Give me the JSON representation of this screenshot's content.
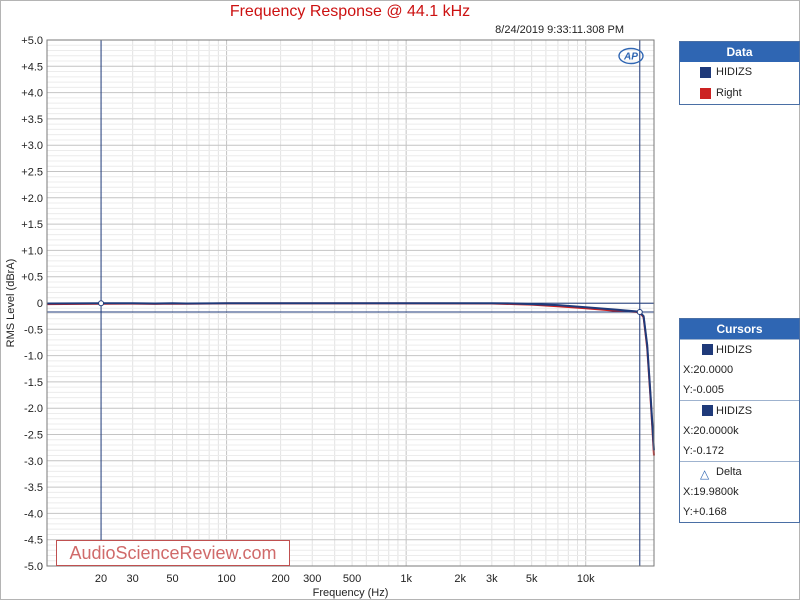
{
  "chart_data": {
    "type": "line",
    "title": "Frequency Response @ 44.1 kHz",
    "timestamp": "8/24/2019 9:33:11.308 PM",
    "xlabel": "Frequency (Hz)",
    "ylabel": "RMS Level (dBrA)",
    "xscale": "log",
    "xlim": [
      10,
      24000
    ],
    "ylim": [
      -5.0,
      5.0
    ],
    "grid": true,
    "x_tick_labels": [
      "20",
      "30",
      "50",
      "100",
      "200",
      "300",
      "500",
      "1k",
      "2k",
      "3k",
      "5k",
      "10k"
    ],
    "x_tick_values": [
      20,
      30,
      50,
      100,
      200,
      300,
      500,
      1000,
      2000,
      3000,
      5000,
      10000
    ],
    "y_tick_labels": [
      "+5.0",
      "+4.5",
      "+4.0",
      "+3.5",
      "+3.0",
      "+2.5",
      "+2.0",
      "+1.5",
      "+1.0",
      "+0.5",
      "0",
      "-0.5",
      "-1.0",
      "-1.5",
      "-2.0",
      "-2.5",
      "-3.0",
      "-3.5",
      "-4.0",
      "-4.5",
      "-5.0"
    ],
    "y_tick_values": [
      5.0,
      4.5,
      4.0,
      3.5,
      3.0,
      2.5,
      2.0,
      1.5,
      1.0,
      0.5,
      0,
      -0.5,
      -1.0,
      -1.5,
      -2.0,
      -2.5,
      -3.0,
      -3.5,
      -4.0,
      -4.5,
      -5.0
    ],
    "series": [
      {
        "name": "HIDIZS",
        "color": "#1f3a7a",
        "x": [
          10,
          20,
          30,
          40,
          50,
          60,
          100,
          500,
          1000,
          3000,
          4000,
          5000,
          7000,
          10000,
          15000,
          19000,
          20000,
          21000,
          22000,
          23000,
          24000
        ],
        "y": [
          -0.01,
          -0.005,
          -0.003,
          -0.01,
          -0.005,
          -0.01,
          -0.003,
          -0.003,
          -0.003,
          -0.003,
          -0.01,
          -0.02,
          -0.04,
          -0.08,
          -0.13,
          -0.16,
          -0.172,
          -0.25,
          -0.8,
          -1.8,
          -2.8
        ]
      },
      {
        "name": "Right",
        "color": "#cc2222",
        "x": [
          10,
          20,
          30,
          40,
          50,
          60,
          100,
          500,
          1000,
          3000,
          4000,
          5000,
          7000,
          10000,
          15000,
          19000,
          20000,
          21000,
          22000,
          23000,
          24000
        ],
        "y": [
          -0.02,
          -0.015,
          -0.012,
          -0.018,
          -0.012,
          -0.015,
          -0.008,
          -0.008,
          -0.008,
          -0.01,
          -0.02,
          -0.03,
          -0.06,
          -0.1,
          -0.15,
          -0.17,
          -0.18,
          -0.27,
          -0.85,
          -1.85,
          -2.9
        ]
      }
    ],
    "cursors": [
      {
        "x": 20,
        "y": -0.005
      },
      {
        "x": 20000,
        "y": -0.172
      }
    ]
  },
  "legend": {
    "header": "Data",
    "items": [
      {
        "label": "HIDIZS",
        "color": "#1f3a7a"
      },
      {
        "label": "Right",
        "color": "#cc2222"
      }
    ]
  },
  "cursors_panel": {
    "header": "Cursors",
    "c1_name": "HIDIZS",
    "c1_x": "X:20.0000",
    "c1_y": "Y:-0.005",
    "c2_name": "HIDIZS",
    "c2_x": "X:20.0000k",
    "c2_y": "Y:-0.172",
    "delta_name": "Delta",
    "delta_x": "X:19.9800k",
    "delta_y": "Y:+0.168",
    "swatch_color": "#1f3a7a"
  },
  "logo_text": "AP",
  "watermark": "AudioScienceReview.com"
}
